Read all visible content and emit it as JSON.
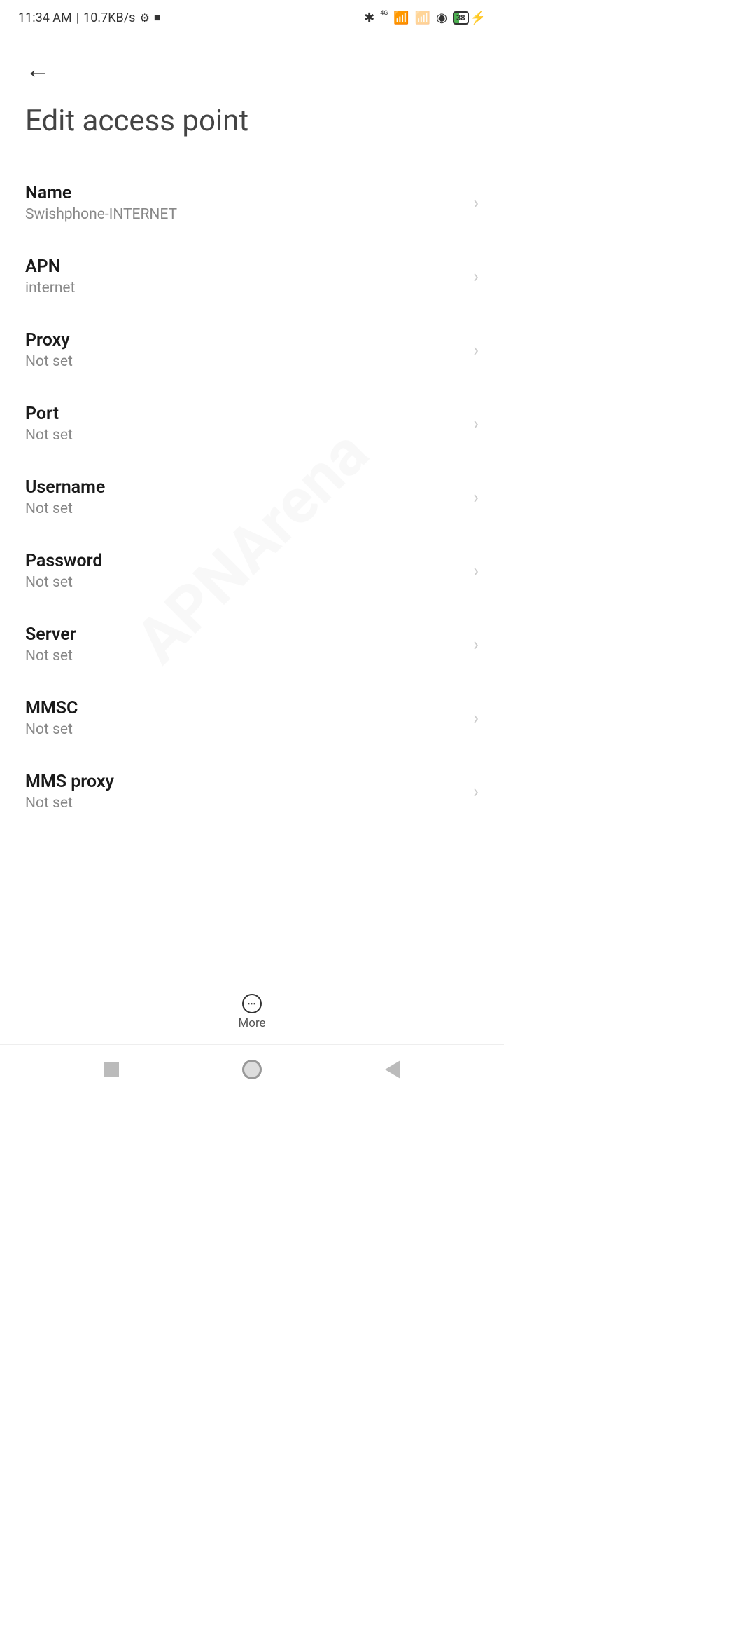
{
  "status_bar": {
    "time": "11:34 AM",
    "separator": "|",
    "data_rate": "10.7KB/s",
    "battery_level": "38",
    "cellular_label": "4G"
  },
  "header": {
    "title": "Edit access point"
  },
  "settings": [
    {
      "label": "Name",
      "value": "Swishphone-INTERNET"
    },
    {
      "label": "APN",
      "value": "internet"
    },
    {
      "label": "Proxy",
      "value": "Not set"
    },
    {
      "label": "Port",
      "value": "Not set"
    },
    {
      "label": "Username",
      "value": "Not set"
    },
    {
      "label": "Password",
      "value": "Not set"
    },
    {
      "label": "Server",
      "value": "Not set"
    },
    {
      "label": "MMSC",
      "value": "Not set"
    },
    {
      "label": "MMS proxy",
      "value": "Not set"
    }
  ],
  "bottom": {
    "more_label": "More"
  },
  "watermark": "APNArena"
}
